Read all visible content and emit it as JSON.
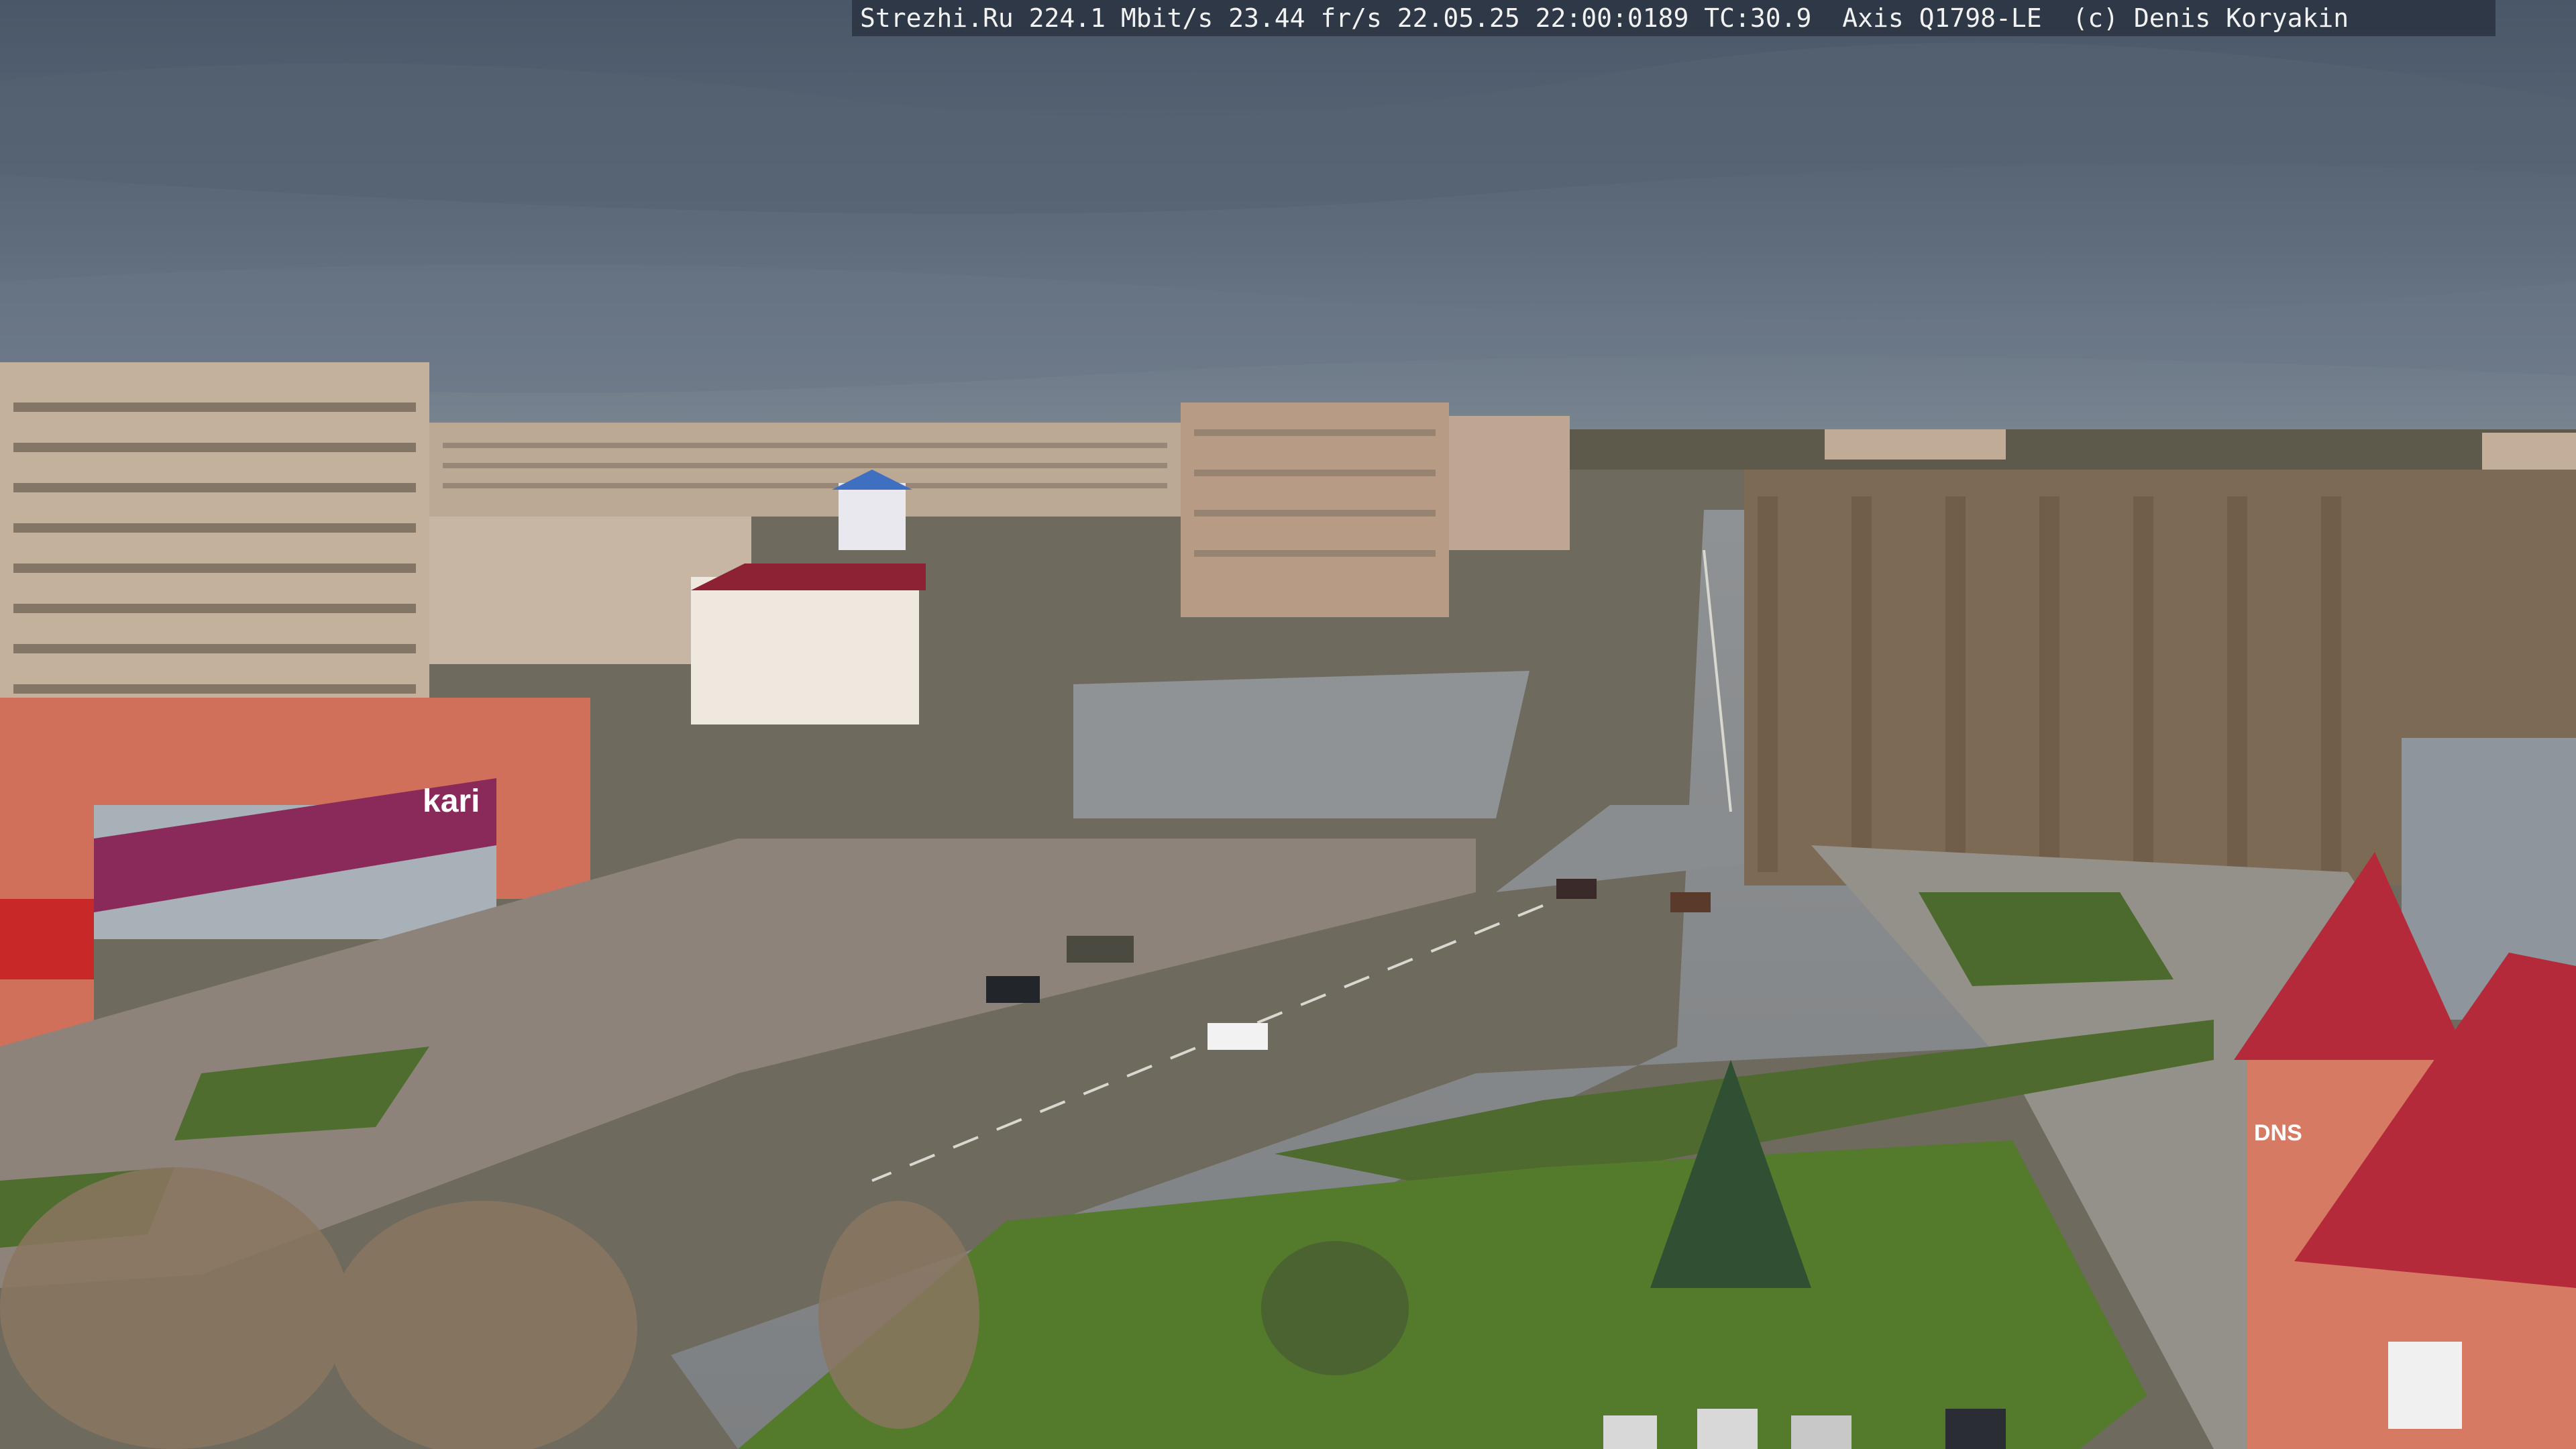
{
  "camera_overlay": {
    "text": "Strezhi.Ru 224.1 Mbit/s 23.44 fr/s 22.05.25 22:00:0189 TC:30.9  Axis Q1798-LE  (c) Denis Koryakin"
  },
  "signage": {
    "store_left": "kari",
    "store_right": "DNS"
  }
}
